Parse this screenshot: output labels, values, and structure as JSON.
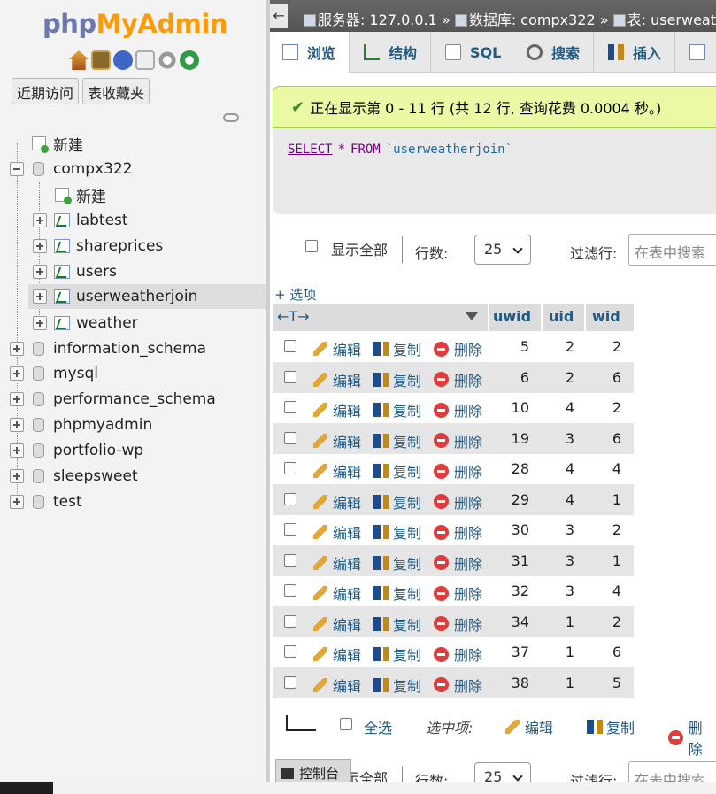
{
  "logo": {
    "part1": "php",
    "part2": "MyAdmin"
  },
  "nav_tabs": {
    "recent": "近期访问",
    "favorites": "表收藏夹"
  },
  "tree": {
    "new_root": "新建",
    "db_compx": "compx322",
    "new_table": "新建",
    "tables": [
      "labtest",
      "shareprices",
      "users",
      "userweatherjoin",
      "weather"
    ],
    "other_dbs": [
      "information_schema",
      "mysql",
      "performance_schema",
      "phpmyadmin",
      "portfolio-wp",
      "sleepsweet",
      "test"
    ],
    "selected": "userweatherjoin"
  },
  "breadcrumb": {
    "server": "服务器: 127.0.0.1",
    "sep": "»",
    "database": "数据库: compx322",
    "table": "表: userweatherjoin"
  },
  "topmenu": {
    "browse": "浏览",
    "structure": "结构",
    "sql": "SQL",
    "search": "搜索",
    "insert": "插入"
  },
  "notice": "正在显示第 0 - 11 行 (共 12 行, 查询花费 0.0004 秒。)",
  "sql": {
    "select": "SELECT",
    "star": "*",
    "from": "FROM",
    "table": "`userweatherjoin`"
  },
  "navbar": {
    "show_all": "显示全部",
    "rows_label": "行数:",
    "rows_value": "25",
    "filter_label": "过滤行:",
    "filter_placeholder": "在表中搜索"
  },
  "options_link": "+ 选项",
  "columns": {
    "arrows": "←T→",
    "uwid": "uwid",
    "uid": "uid",
    "wid": "wid"
  },
  "row_actions": {
    "edit": "编辑",
    "copy": "复制",
    "delete": "删除"
  },
  "rows": [
    {
      "uwid": "5",
      "uid": "2",
      "wid": "2"
    },
    {
      "uwid": "6",
      "uid": "2",
      "wid": "6"
    },
    {
      "uwid": "10",
      "uid": "4",
      "wid": "2"
    },
    {
      "uwid": "19",
      "uid": "3",
      "wid": "6"
    },
    {
      "uwid": "28",
      "uid": "4",
      "wid": "4"
    },
    {
      "uwid": "29",
      "uid": "4",
      "wid": "1"
    },
    {
      "uwid": "30",
      "uid": "3",
      "wid": "2"
    },
    {
      "uwid": "31",
      "uid": "3",
      "wid": "1"
    },
    {
      "uwid": "32",
      "uid": "3",
      "wid": "4"
    },
    {
      "uwid": "34",
      "uid": "1",
      "wid": "2"
    },
    {
      "uwid": "37",
      "uid": "1",
      "wid": "6"
    },
    {
      "uwid": "38",
      "uid": "1",
      "wid": "5"
    }
  ],
  "bulk": {
    "select_all": "全选",
    "with_selected": "选中项:",
    "edit": "编辑",
    "copy": "复制",
    "delete": "删除"
  },
  "console": "控制台"
}
